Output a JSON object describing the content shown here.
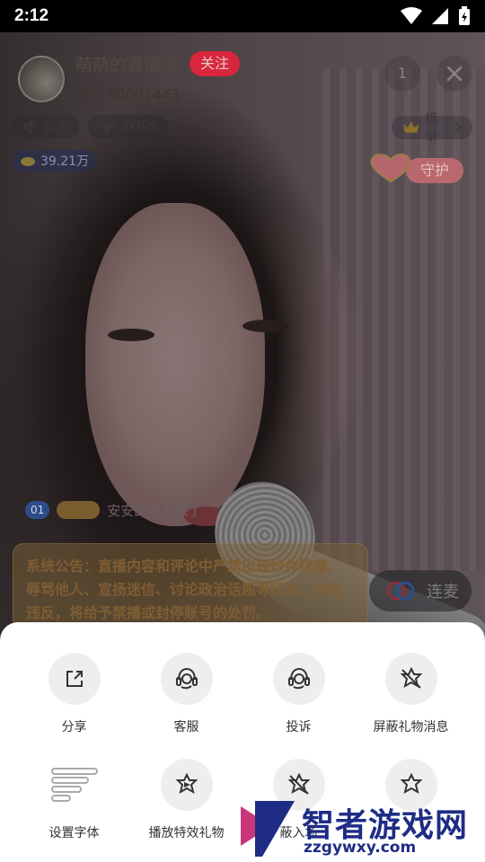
{
  "status_bar": {
    "time": "2:12"
  },
  "room": {
    "title": "萌萌的直播间",
    "follow_label": "关注",
    "id_text": "ID：60001443",
    "viewer_count": "1",
    "notice_label": "公告",
    "speed": "3KB/S",
    "rank_label": "榜单",
    "coins": "39.21万",
    "guard_label": "守护"
  },
  "chat": {
    "level_badge": "01",
    "name_fragment": "安安的宅宅来了"
  },
  "system_notice": {
    "text": "系统公告：直播内容和评论中严禁出现炒作炫富、辱骂他人、宣扬迷信、讨论政治话题等行为，如有违反，将给予禁播或封停账号的处罚。"
  },
  "connect_button": {
    "label": "连麦"
  },
  "sheet": {
    "items": [
      {
        "label": "分享",
        "icon": "share-icon"
      },
      {
        "label": "客服",
        "icon": "customer-service-icon"
      },
      {
        "label": "投诉",
        "icon": "complaint-icon"
      },
      {
        "label": "屏蔽礼物消息",
        "icon": "block-gift-message-icon"
      },
      {
        "label": "设置字体",
        "icon": "font-settings-icon"
      },
      {
        "label": "播放特效礼物",
        "icon": "play-gift-effects-icon"
      },
      {
        "label": "蔽入场",
        "icon": "block-entry-icon"
      },
      {
        "label": "",
        "icon": "gift-sound-icon"
      }
    ]
  },
  "watermark": {
    "title": "智者游戏网",
    "domain": "zzgywxy.com"
  },
  "colors": {
    "follow": "#d9263c",
    "sheet_bg": "#ffffff",
    "icon_circle": "#eeeeee",
    "watermark": "#1e2c86"
  }
}
